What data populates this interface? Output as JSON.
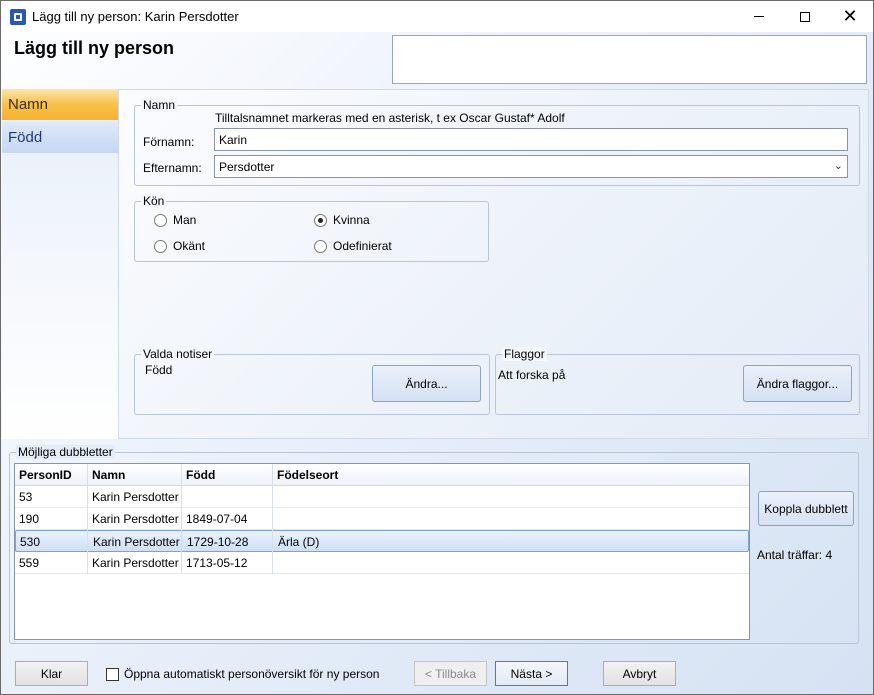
{
  "window": {
    "title": "Lägg till ny person: Karin Persdotter"
  },
  "header": {
    "title": "Lägg till ny person"
  },
  "nav": {
    "items": [
      {
        "label": "Namn",
        "active": true
      },
      {
        "label": "Född",
        "active": false
      }
    ]
  },
  "name_group": {
    "legend": "Namn",
    "hint": "Tilltalsnamnet markeras med en asterisk, t ex  Oscar Gustaf* Adolf",
    "first_name_label": "Förnamn:",
    "first_name_value": "Karin",
    "last_name_label": "Efternamn:",
    "last_name_value": "Persdotter"
  },
  "gender_group": {
    "legend": "Kön",
    "options": [
      {
        "label": "Man",
        "checked": false
      },
      {
        "label": "Kvinna",
        "checked": true
      },
      {
        "label": "Okänt",
        "checked": false
      },
      {
        "label": "Odefinierat",
        "checked": false
      }
    ]
  },
  "notes_group": {
    "legend": "Valda notiser",
    "value": "Född",
    "button": "Ändra..."
  },
  "flags_group": {
    "legend": "Flaggor",
    "value": "Att forska på",
    "button": "Ändra flaggor..."
  },
  "duplicates": {
    "legend": "Möjliga dubbletter",
    "columns": [
      "PersonID",
      "Namn",
      "Född",
      "Födelseort"
    ],
    "rows": [
      [
        "53",
        "Karin Persdotter",
        "",
        ""
      ],
      [
        "190",
        "Karin Persdotter",
        "1849-07-04",
        ""
      ],
      [
        "530",
        "Karin Persdotter",
        "1729-10-28",
        "Ärla (D)"
      ],
      [
        "559",
        "Karin Persdotter",
        "1713-05-12",
        ""
      ]
    ],
    "selected_row": 2,
    "link_button": "Koppla dubblett",
    "hits_label": "Antal träffar: 4"
  },
  "footer": {
    "done": "Klar",
    "auto_open_label": "Öppna automatiskt personöversikt för ny person",
    "auto_open_checked": false,
    "back": "< Tillbaka",
    "next": "Nästa >",
    "cancel": "Avbryt"
  }
}
